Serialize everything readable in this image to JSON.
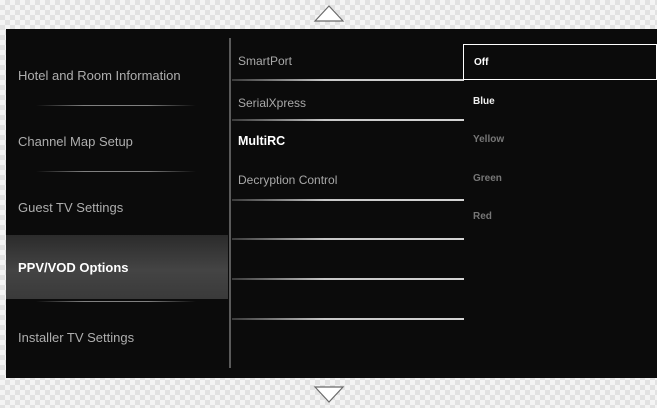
{
  "menu": {
    "items": [
      {
        "label": "Hotel and Room Information"
      },
      {
        "label": "Channel Map Setup"
      },
      {
        "label": "Guest TV Settings"
      },
      {
        "label": "PPV/VOD Options"
      },
      {
        "label": "Installer TV Settings"
      }
    ],
    "active_index": 3
  },
  "submenu": {
    "items": [
      {
        "label": "SmartPort"
      },
      {
        "label": "SerialXpress"
      },
      {
        "label": "MultiRC"
      },
      {
        "label": "Decryption Control"
      }
    ],
    "focused_index": 2
  },
  "options": {
    "items": [
      {
        "label": "Off"
      },
      {
        "label": "Blue"
      },
      {
        "label": "Yellow"
      },
      {
        "label": "Green"
      },
      {
        "label": "Red"
      }
    ],
    "selected_index": 0
  },
  "colors": {
    "background": "#0b0b0b",
    "active_item": "#3c3c3c",
    "text_dim": "#aeaeae",
    "text_active": "#ffffff"
  },
  "icons": [
    "scroll-up-icon",
    "scroll-down-icon"
  ]
}
